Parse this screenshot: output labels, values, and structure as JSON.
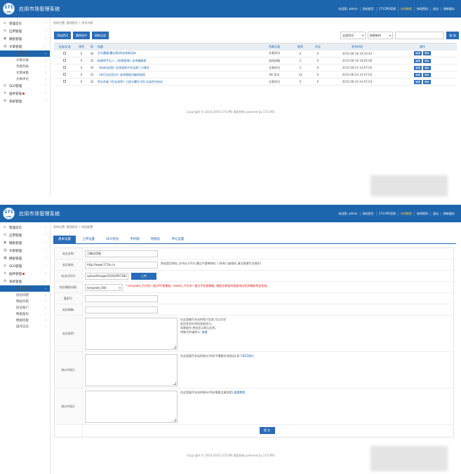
{
  "app_title": "应用市场管理系统",
  "logo_text": "171",
  "logo_sub": "CMS",
  "topnav": [
    "欢迎您, admin",
    "网站首页",
    "171CMS官网",
    "在线教程",
    "修改密码",
    "退出",
    "刷新缓存"
  ],
  "sidebar1": [
    {
      "label": "管理首页",
      "icon": "home-icon"
    },
    {
      "label": "应用管理",
      "icon": "list-icon"
    },
    {
      "label": "模板管理",
      "icon": "palette-icon"
    },
    {
      "label": "文章管理",
      "icon": "document-icon"
    }
  ],
  "sidebar1_sub": [
    "文章列表",
    "文章分类",
    "专题列表",
    "文章采集",
    "文章评论"
  ],
  "sidebar1_rest": [
    {
      "label": "SEO管理",
      "icon": "seo-icon"
    },
    {
      "label": "插件管理",
      "icon": "puzzle-icon"
    },
    {
      "label": "系统管理",
      "icon": "gear-icon"
    }
  ],
  "list_crumb": "您的位置: 管理首页 > 资讯列表",
  "list_buttons": [
    "添加资讯",
    "删除选中",
    "刷新全部"
  ],
  "search": {
    "category": "全部资讯",
    "sort": "按更新时",
    "button": "查 询"
  },
  "list_table": {
    "headers": [
      "全选/反选",
      "排序",
      "ID",
      "标题",
      "所属分类",
      "推荐",
      "评论",
      "发布时间",
      "操作"
    ],
    "rows": [
      {
        "order": "0",
        "id": "36",
        "title": "沉鸟魔蛋(魔幻版)的动态新动向",
        "cat": "文章资讯",
        "rec": "0",
        "cmt": "0",
        "time": "2015-06-16 19:43:42"
      },
      {
        "order": "0",
        "id": "35",
        "title": "枪弹杀手后人:《恐怖营地》安卓最新版",
        "cat": "游戏攻略",
        "rec": "2",
        "cmt": "0",
        "time": "2015-06-16 18:05:06"
      },
      {
        "order": "0",
        "id": "34",
        "title": "《KaKa说游》在线游戏平台运营三大模式",
        "cat": "文章资讯",
        "rec": "1",
        "cmt": "0",
        "time": "2015-06-23 14:07:03"
      },
      {
        "order": "0",
        "id": "33",
        "title": "《辛巴达历险记》安卓版新功能的秘密",
        "cat": "KK 资讯",
        "rec": "33",
        "cmt": "0",
        "time": "2015-06-23 14:07:03"
      },
      {
        "order": "0",
        "id": "32",
        "title": "积分升级《生存战争》已经与腾讯 QQ 达成合作协议",
        "cat": "文章资讯",
        "rec": "0",
        "cmt": "0",
        "time": "2015-06-23 14:07:54"
      }
    ],
    "edit_label": "编辑",
    "del_label": "删除"
  },
  "copyright": "Copyright © 2014-2016 171CMS 版权所有 powered by 171CMS",
  "copyright_link": "171CMS",
  "sidebar2": [
    {
      "label": "管理首页",
      "icon": "home-icon"
    },
    {
      "label": "应用管理",
      "icon": "list-icon"
    },
    {
      "label": "模板管理",
      "icon": "palette-icon"
    },
    {
      "label": "文章管理",
      "icon": "document-icon"
    },
    {
      "label": "模板管理",
      "icon": "template-icon"
    },
    {
      "label": "SEO管理",
      "icon": "seo-icon"
    },
    {
      "label": "插件管理",
      "icon": "puzzle-icon"
    },
    {
      "label": "系统管理",
      "icon": "gear-icon"
    }
  ],
  "sidebar2_sub": [
    "网站配置",
    "验证码配",
    "网站导航",
    "后台账户",
    "数据备份",
    "数据恢复",
    "操作日志"
  ],
  "settings_crumb": "您的位置: 管理首页 > 网站配置",
  "tabs": [
    "基本设置",
    "上传设置",
    "SEO优化",
    "手机版",
    "伪静态",
    "评论设置"
  ],
  "form": {
    "site_name_label": "站点名称:",
    "site_name": "万象应用网",
    "site_url_label": "站点域名:",
    "site_url": "http://www.171tv.cn",
    "site_url_hint": "网站首页网址,以http://开头,最后不要带斜杠 / (如有二级域名,请注意填写全域名)",
    "logo_label": "站点LOGO:",
    "logo_path": "upload/image/2016/4f07281",
    "upload_btn": "上传",
    "template_label": "前台模板风格:",
    "template_value": "template_000",
    "template_hint": "* template_开头的一般为PC版模板, mobile_开头的一般为手机版模板, 模板名称请勿随意改动否则模板将会失效。",
    "icp_label": "备案号:",
    "email_label": "站长邮箱:",
    "stats_label": "站点说明:",
    "stats_hint": [
      "在这里编写本站的简介信息,可以为空",
      "此信息会在网站底部显示。",
      "如果留空,将会显示默认信息。",
      "特殊字符请转义: "
    ],
    "stats_link": "查看",
    "code1_label": "统计代码1:",
    "code1_hint": "在这里填写本站的统计代码(不需要任何改动),如 ",
    "code1_link": "CNZZ统计",
    "code2_label": "统计代码2:",
    "code2_hint": "在这里填写本站的统计代码(需要注意的是),",
    "code2_link": "查看教程",
    "submit": "提 交"
  }
}
